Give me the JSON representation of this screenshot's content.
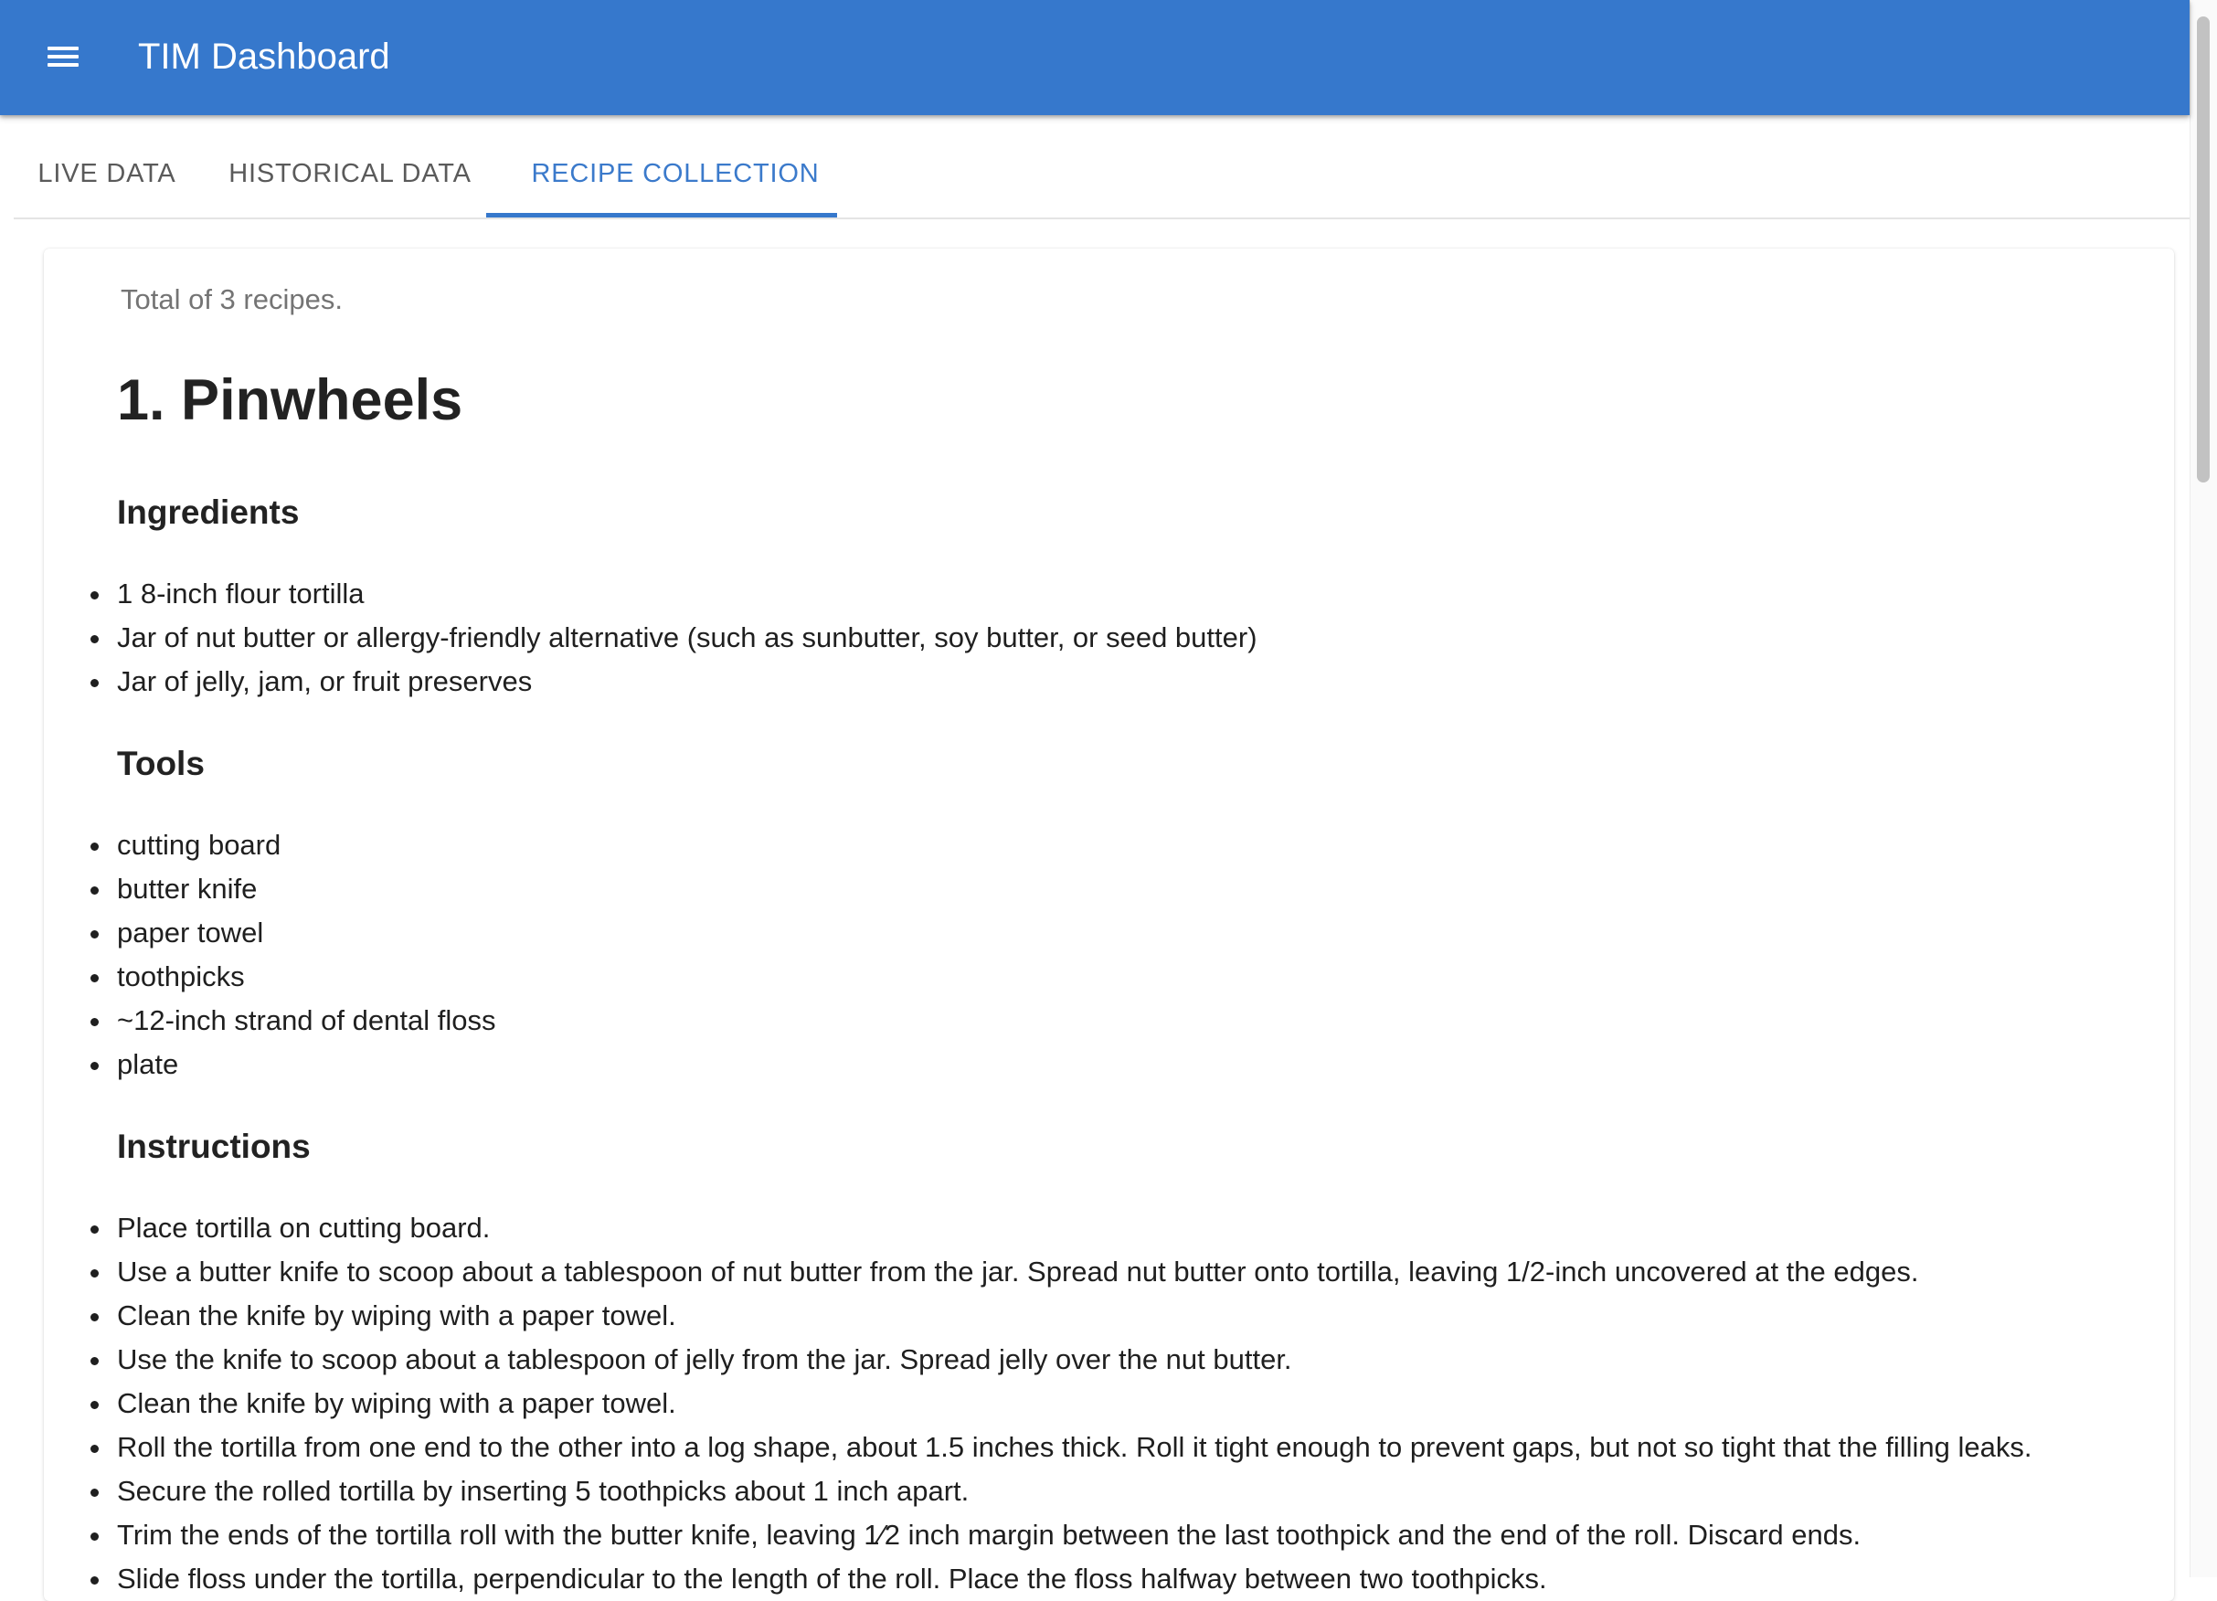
{
  "appbar": {
    "title": "TIM Dashboard",
    "menu_icon": "menu-icon",
    "color": "#3678cc"
  },
  "tabs": [
    {
      "label": "LIVE DATA",
      "active": false
    },
    {
      "label": "HISTORICAL DATA",
      "active": false
    },
    {
      "label": "RECIPE COLLECTION",
      "active": true
    }
  ],
  "recipes": {
    "summary": "Total of 3 recipes.",
    "recipe": {
      "title": "1. Pinwheels",
      "ingredients_heading": "Ingredients",
      "ingredients": [
        "1 8-inch flour tortilla",
        "Jar of nut butter or allergy-friendly alternative (such as sunbutter, soy butter, or seed butter)",
        "Jar of jelly, jam, or fruit preserves"
      ],
      "tools_heading": "Tools",
      "tools": [
        "cutting board",
        "butter knife",
        "paper towel",
        "toothpicks",
        "~12-inch strand of dental floss",
        "plate"
      ],
      "instructions_heading": "Instructions",
      "instructions": [
        "Place tortilla on cutting board.",
        "Use a butter knife to scoop about a tablespoon of nut butter from the jar. Spread nut butter onto tortilla, leaving 1/2-inch uncovered at the edges.",
        "Clean the knife by wiping with a paper towel.",
        "Use the knife to scoop about a tablespoon of jelly from the jar. Spread jelly over the nut butter.",
        "Clean the knife by wiping with a paper towel.",
        "Roll the tortilla from one end to the other into a log shape, about 1.5 inches thick. Roll it tight enough to prevent gaps, but not so tight that the filling leaks.",
        "Secure the rolled tortilla by inserting 5 toothpicks about 1 inch apart.",
        "Trim the ends of the tortilla roll with the butter knife, leaving 1⁄2 inch margin between the last toothpick and the end of the roll. Discard ends.",
        "Slide floss under the tortilla, perpendicular to the length of the roll. Place the floss halfway between two toothpicks."
      ]
    }
  }
}
